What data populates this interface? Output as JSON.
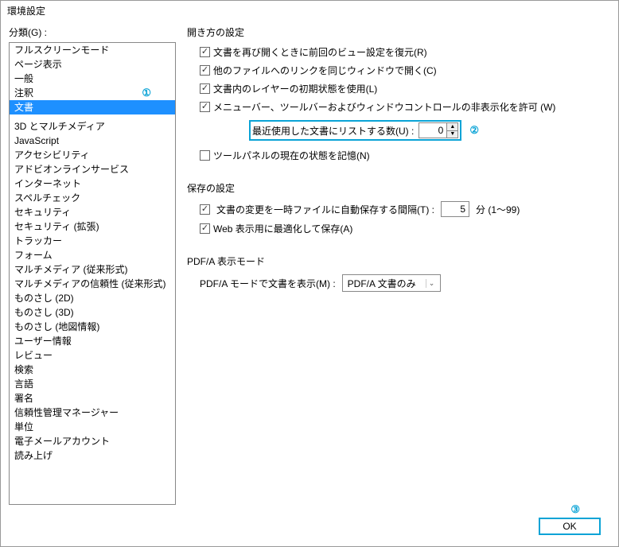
{
  "window": {
    "title": "環境設定"
  },
  "sidebar": {
    "label": "分類(G) :",
    "items": [
      "フルスクリーンモード",
      "ページ表示",
      "一般",
      "注釈",
      "文書",
      "3D とマルチメディア",
      "JavaScript",
      "アクセシビリティ",
      "アドビオンラインサービス",
      "インターネット",
      "スペルチェック",
      "セキュリティ",
      "セキュリティ (拡張)",
      "トラッカー",
      "フォーム",
      "マルチメディア (従来形式)",
      "マルチメディアの信頼性 (従来形式)",
      "ものさし (2D)",
      "ものさし (3D)",
      "ものさし (地図情報)",
      "ユーザー情報",
      "レビュー",
      "検索",
      "言語",
      "署名",
      "信頼性管理マネージャー",
      "単位",
      "電子メールアカウント",
      "読み上げ"
    ],
    "selected_index": 4,
    "annotation_index": 3,
    "annotation_label": "①"
  },
  "groups": {
    "open": {
      "title": "開き方の設定",
      "cb_restore": "文書を再び開くときに前回のビュー設定を復元(R)",
      "cb_links": "他のファイルへのリンクを同じウィンドウで開く(C)",
      "cb_layers": "文書内のレイヤーの初期状態を使用(L)",
      "cb_hidectrls": "メニューバー、ツールバーおよびウィンドウコントロールの非表示化を許可 (W)",
      "recent_label": "最近使用した文書にリストする数(U) :",
      "recent_value": "0",
      "recent_annot": "②",
      "cb_toolpanel": "ツールパネルの現在の状態を記憶(N)"
    },
    "save": {
      "title": "保存の設定",
      "cb_autosave": "文書の変更を一時ファイルに自動保存する間隔(T) :",
      "autosave_value": "5",
      "autosave_unit": "分  (1～99)",
      "cb_webopt": "Web 表示用に最適化して保存(A)"
    },
    "pdfa": {
      "title": "PDF/A 表示モード",
      "label": "PDF/A モードで文書を表示(M) :",
      "selected": "PDF/A 文書のみ"
    }
  },
  "footer": {
    "ok": "OK",
    "annot": "③"
  }
}
